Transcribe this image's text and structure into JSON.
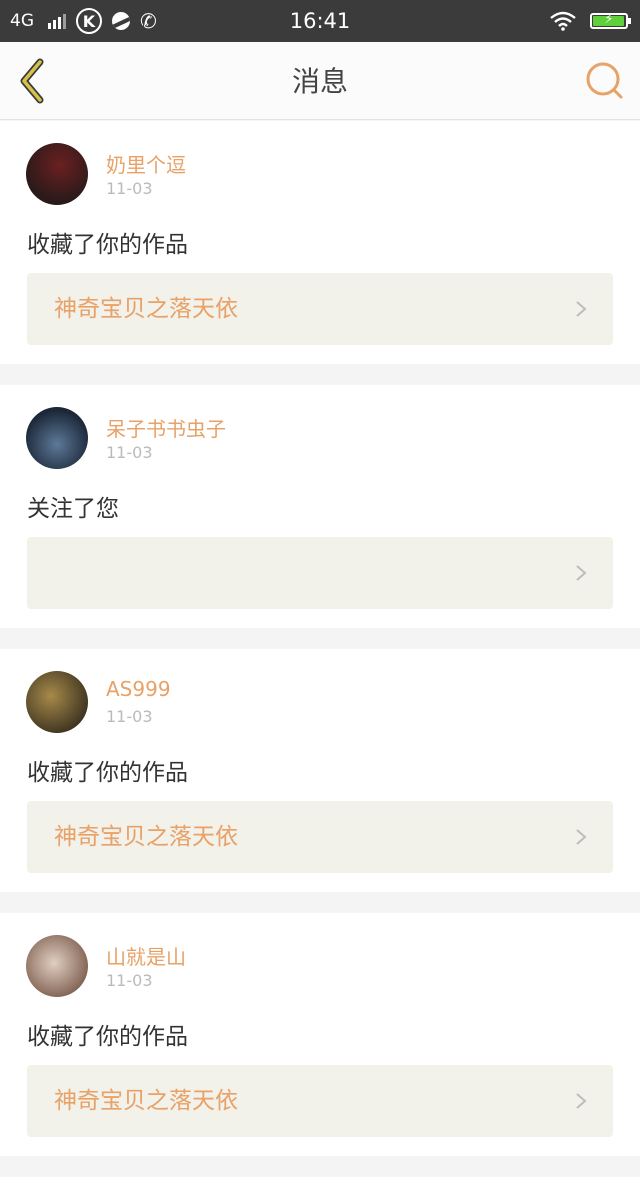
{
  "status_bar": {
    "network": "4G",
    "k_badge": "K",
    "time": "16:41",
    "icons": [
      "signal-icon",
      "k-app-icon",
      "ball-app-icon",
      "phone-icon",
      "wifi-icon",
      "battery-icon"
    ],
    "battery_charging": true
  },
  "header": {
    "title": "消息",
    "back_icon": "back-chevron-icon",
    "search_icon": "search-icon",
    "accent_color": "#e8a166",
    "back_color": "#d6c14b"
  },
  "messages": [
    {
      "user": "奶里个逗",
      "date": "11-03",
      "action": "收藏了你的作品",
      "work_title": "神奇宝贝之落天依",
      "avatar_colors": [
        "#2a1a1a",
        "#6b2020"
      ]
    },
    {
      "user": "呆子书书虫子",
      "date": "11-03",
      "action": "关注了您",
      "work_title": "",
      "avatar_colors": [
        "#1c2838",
        "#5d7a99"
      ]
    },
    {
      "user": "AS999",
      "date": "11-03",
      "action": "收藏了你的作品",
      "work_title": "神奇宝贝之落天依",
      "avatar_colors": [
        "#3d3420",
        "#a78a4a"
      ]
    },
    {
      "user": "山就是山",
      "date": "11-03",
      "action": "收藏了你的作品",
      "work_title": "神奇宝贝之落天依",
      "avatar_colors": [
        "#7a5a4a",
        "#e0cfc2"
      ]
    }
  ]
}
